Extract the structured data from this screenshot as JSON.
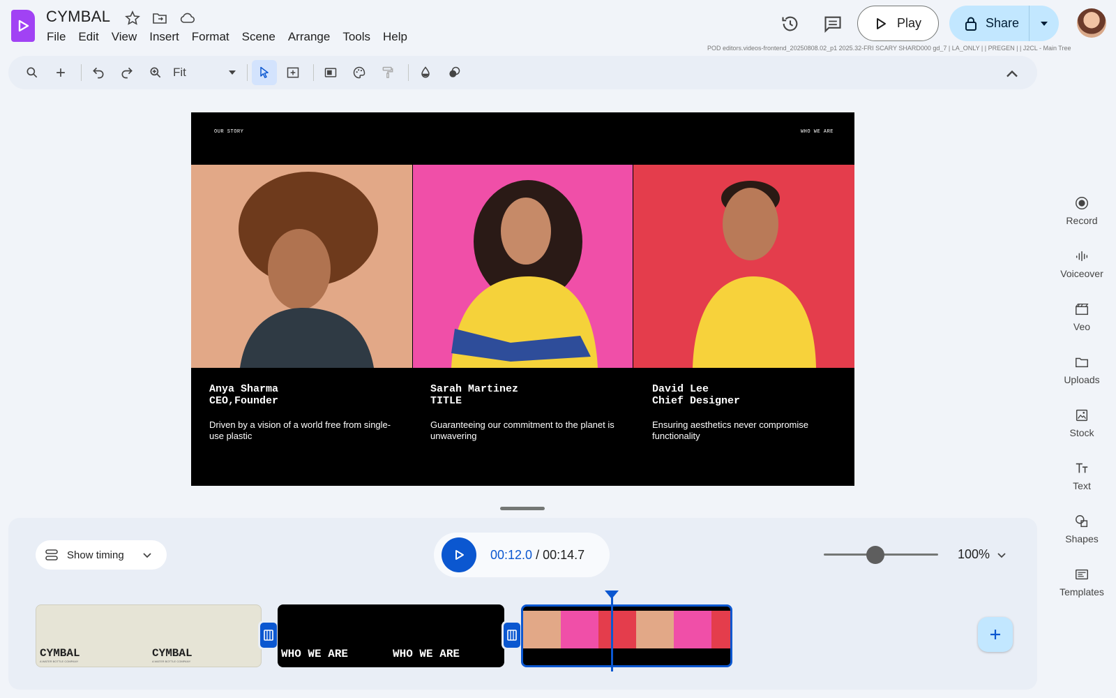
{
  "app": {
    "title": "CYMBAL",
    "build_info": "POD editors.videos-frontend_20250808.02_p1 2025.32-FRI SCARY SHARD000 gd_7 | LA_ONLY | | PREGEN | | J2CL - Main Tree"
  },
  "menu": [
    "File",
    "Edit",
    "View",
    "Insert",
    "Format",
    "Scene",
    "Arrange",
    "Tools",
    "Help"
  ],
  "header": {
    "play_label": "Play",
    "share_label": "Share"
  },
  "toolbar": {
    "zoom_value": "Fit"
  },
  "slide": {
    "top_left": "OUR STORY",
    "top_right": "WHO WE ARE",
    "people": [
      {
        "name": "Anya Sharma\nCEO,Founder",
        "desc": "Driven by a vision of a world free from single-use plastic"
      },
      {
        "name": "Sarah Martinez\nTITLE",
        "desc": "Guaranteeing our commitment to the planet is unwavering"
      },
      {
        "name": "David Lee\nChief Designer",
        "desc": "Ensuring aesthetics never compromise functionality"
      }
    ]
  },
  "timeline": {
    "show_timing_label": "Show timing",
    "current_time": "00:12.0",
    "separator": " / ",
    "total_time": "00:14.7",
    "zoom_percent": "100%",
    "zoom_level": 0.45,
    "clips": [
      {
        "label_a": "CYMBAL",
        "label_b": "CYMBAL",
        "sub": "A WATER BOTTLE COMPANY"
      },
      {
        "label_a": "WHO WE ARE",
        "label_b": "WHO WE ARE"
      }
    ]
  },
  "side_panel": [
    "Record",
    "Voiceover",
    "Veo",
    "Uploads",
    "Stock",
    "Text",
    "Shapes",
    "Templates"
  ],
  "colors": {
    "accent": "#0b57d0",
    "logo": "#a142f4",
    "share_bg": "#c2e7ff",
    "photo1": "#e2a887",
    "photo2": "#f04fa8",
    "photo3": "#e43d4c"
  }
}
